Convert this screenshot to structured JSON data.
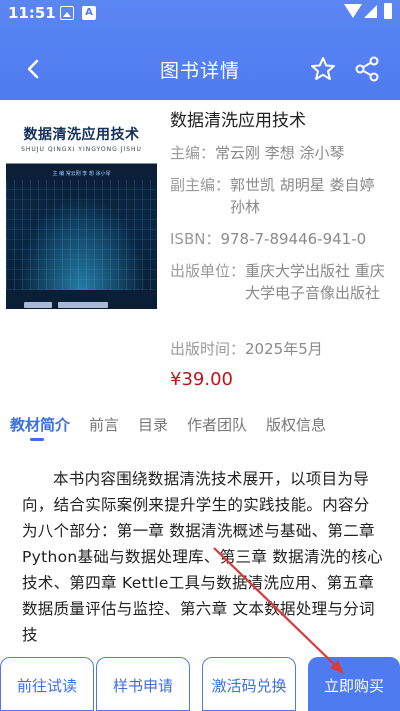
{
  "status": {
    "time": "11:51",
    "a_badge": "A"
  },
  "header": {
    "title": "图书详情"
  },
  "cover": {
    "title": "数据清洗应用技术",
    "pinyin": "SHUJU QINGXI YINGYONG JISHU",
    "authors": "主 编 常云刚   李 想   涂小琴"
  },
  "book": {
    "name": "数据清洗应用技术",
    "editor_label": "主编：",
    "editor_value": "常云刚 李想 涂小琴",
    "sub_editor_label": "副主编：",
    "sub_editor_value": "郭世凯 胡明星 娄自婷 孙林",
    "isbn_label": "ISBN：",
    "isbn_value": "978-7-89446-941-0",
    "publisher_label": "出版单位：",
    "publisher_value": "重庆大学出版社 重庆大学电子音像出版社",
    "date_label": "出版时间：",
    "date_value": "2025年5月",
    "price": "¥39.00"
  },
  "tabs": [
    {
      "label": "教材简介",
      "active": true
    },
    {
      "label": "前言",
      "active": false
    },
    {
      "label": "目录",
      "active": false
    },
    {
      "label": "作者团队",
      "active": false
    },
    {
      "label": "版权信息",
      "active": false
    }
  ],
  "description": "本书内容围绕数据清洗技术展开，以项目为导向，结合实际案例来提升学生的实践技能。内容分为八个部分：第一章 数据清洗概述与基础、第二章 Python基础与数据处理库、第三章 数据清洗的核心技术、第四章 Kettle工具与数据清洗应用、第五章 数据质量评估与监控、第六章 文本数据处理与分词技",
  "bottom_buttons": {
    "trial": "前往试读",
    "sample": "样书申请",
    "activate": "激活码兑换",
    "buy": "立即购买"
  },
  "colors": {
    "accent": "#4f7bf0",
    "price": "#c4121b",
    "annotation_arrow": "#d93a3a"
  }
}
